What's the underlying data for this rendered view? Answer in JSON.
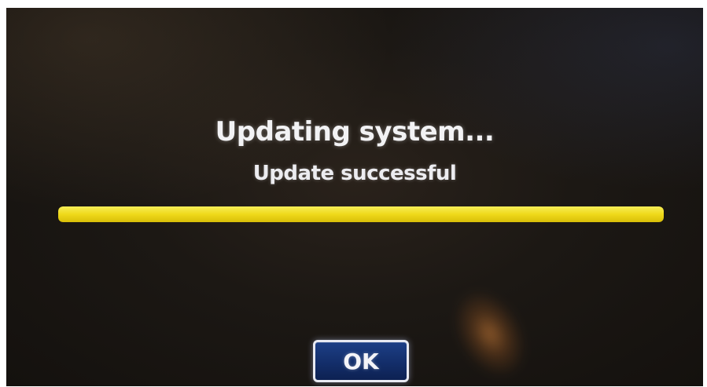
{
  "dialog": {
    "title": "Updating system...",
    "status": "Update successful",
    "ok_label": "OK"
  },
  "progress": {
    "fraction": 1.0
  },
  "colors": {
    "screen_background": "#1c1814",
    "progress_fill": "#efd91a",
    "button_background": "#132e6a",
    "button_border": "#e8eaf2",
    "text": "#f2f2f4"
  }
}
